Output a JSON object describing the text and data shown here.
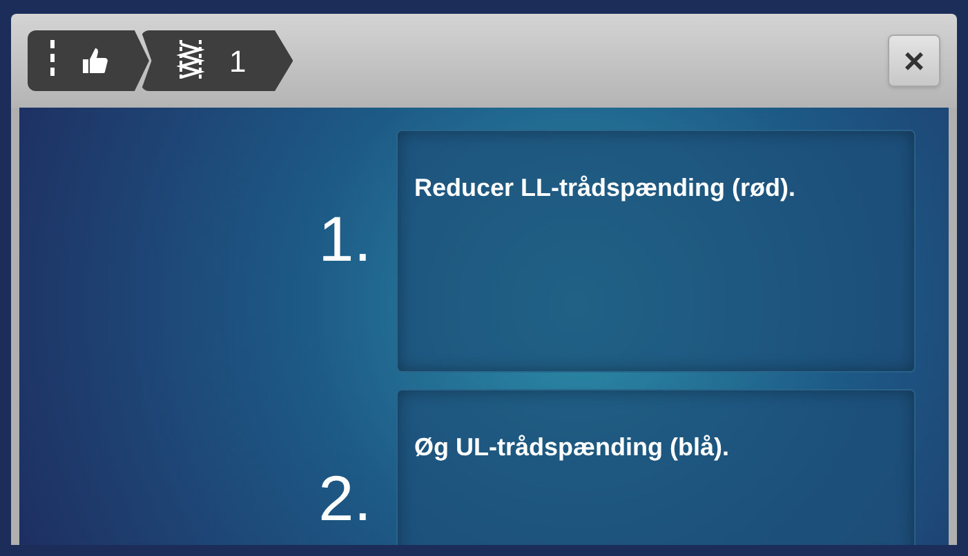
{
  "breadcrumb": [
    {
      "kind": "hand"
    },
    {
      "kind": "stitch",
      "label": "1"
    }
  ],
  "close_button": {
    "label": "×"
  },
  "steps": [
    {
      "number": "1.",
      "text": "Reducer LL-trådspænding (rød)."
    },
    {
      "number": "2.",
      "text": "Øg UL-trådspænding (blå)."
    }
  ]
}
